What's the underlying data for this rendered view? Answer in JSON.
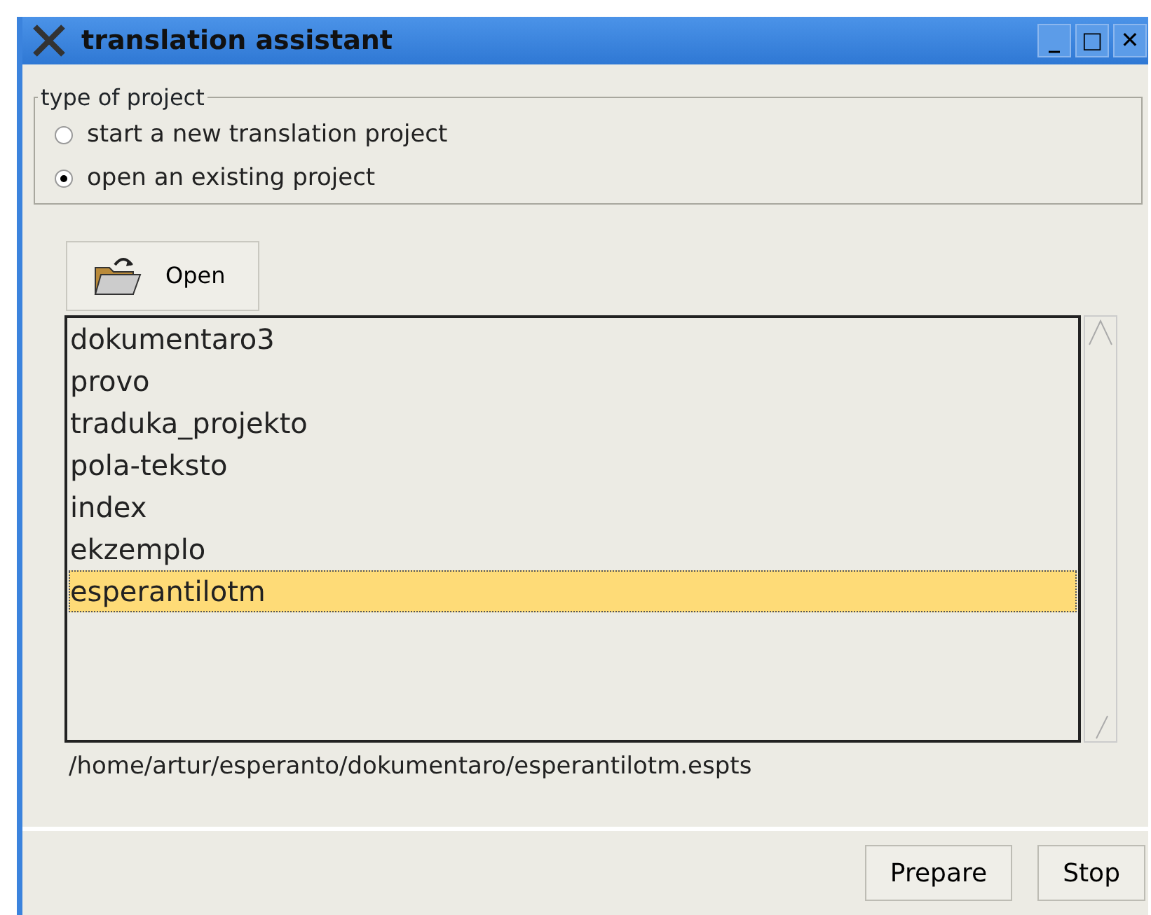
{
  "window": {
    "title": "translation assistant",
    "controls": [
      "_",
      "□",
      "✕"
    ]
  },
  "project_type": {
    "legend": "type of project",
    "options": [
      {
        "label": "start a new translation project",
        "selected": false
      },
      {
        "label": "open an existing project",
        "selected": true
      }
    ]
  },
  "open_button": {
    "label": "Open"
  },
  "projects": [
    {
      "name": "dokumentaro3",
      "selected": false
    },
    {
      "name": "provo",
      "selected": false
    },
    {
      "name": "traduka_projekto",
      "selected": false
    },
    {
      "name": "pola-teksto",
      "selected": false
    },
    {
      "name": "index",
      "selected": false
    },
    {
      "name": "ekzemplo",
      "selected": false
    },
    {
      "name": "esperantilotm",
      "selected": true
    }
  ],
  "path": "/home/artur/esperanto/dokumentaro/esperantilotm.espts",
  "buttons": [
    "Prepare",
    "Stop"
  ]
}
